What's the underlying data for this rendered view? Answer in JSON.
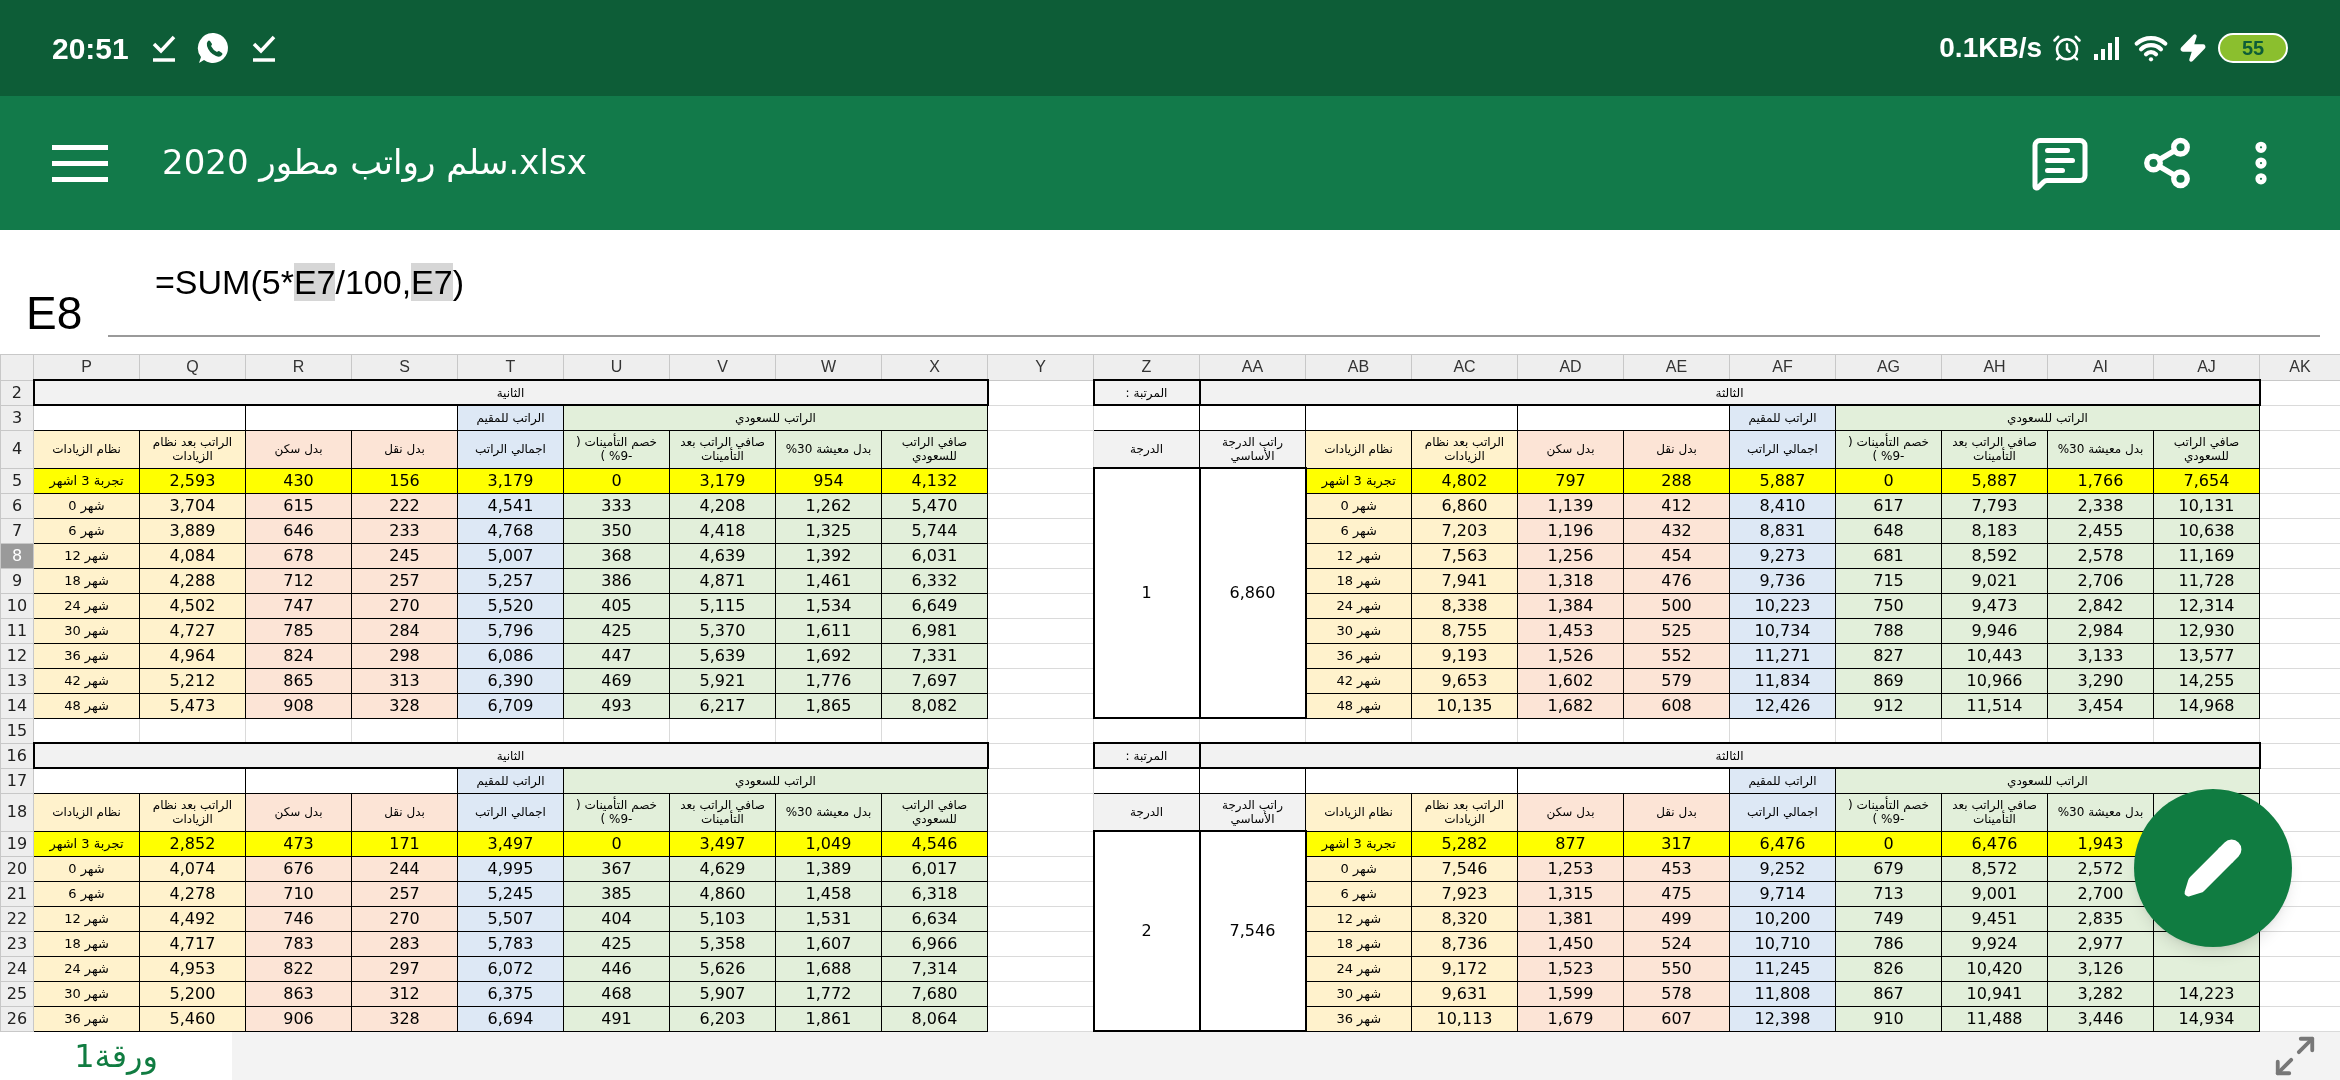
{
  "status_bar": {
    "time": "20:51",
    "network_speed": "0.1KB/s",
    "battery": "55"
  },
  "app_bar": {
    "title": "سلم رواتب مطور 2020.xlsx"
  },
  "formula_bar": {
    "cell": "E8",
    "formula": [
      {
        "text": "=SUM(5*",
        "ref": false
      },
      {
        "text": "E7",
        "ref": true
      },
      {
        "text": "/100,",
        "ref": false
      },
      {
        "text": "E7",
        "ref": true
      },
      {
        "text": ")",
        "ref": false
      }
    ]
  },
  "columns": [
    "P",
    "Q",
    "R",
    "S",
    "T",
    "U",
    "V",
    "W",
    "X",
    "Y",
    "Z",
    "AA",
    "AB",
    "AC",
    "AD",
    "AE",
    "AF",
    "AG",
    "AH",
    "AI",
    "AJ",
    "AK"
  ],
  "row_headers": [
    {
      "label": "2",
      "selected": false
    },
    {
      "label": "3",
      "selected": false
    },
    {
      "label": "4",
      "selected": false
    },
    {
      "label": "5",
      "selected": false
    },
    {
      "label": "6",
      "selected": false
    },
    {
      "label": "7",
      "selected": false
    },
    {
      "label": "8",
      "selected": true
    },
    {
      "label": "9",
      "selected": false
    },
    {
      "label": "10",
      "selected": false
    },
    {
      "label": "11",
      "selected": false
    },
    {
      "label": "12",
      "selected": false
    },
    {
      "label": "13",
      "selected": false
    },
    {
      "label": "14",
      "selected": false
    },
    {
      "label": "15",
      "selected": false
    },
    {
      "label": "16",
      "selected": false
    },
    {
      "label": "17",
      "selected": false
    },
    {
      "label": "18",
      "selected": false
    },
    {
      "label": "19",
      "selected": false
    },
    {
      "label": "20",
      "selected": false
    },
    {
      "label": "21",
      "selected": false
    },
    {
      "label": "22",
      "selected": false
    },
    {
      "label": "23",
      "selected": false
    },
    {
      "label": "24",
      "selected": false
    },
    {
      "label": "25",
      "selected": false
    },
    {
      "label": "26",
      "selected": false
    }
  ],
  "bands": [
    {
      "left": {
        "title": "الثانية",
        "resident_group": "الراتب للمقيم",
        "saudi_group": "الراتب للسعودي",
        "headers": [
          {
            "label": "صافي الراتب للسعودي",
            "color": "#e2efda"
          },
          {
            "label": "بدل معيشة 30%",
            "color": "#e2efda"
          },
          {
            "label": "صافي الراتب بعد التأمينات",
            "color": "#e2efda"
          },
          {
            "label": "خصم التأمينات ( -9% )",
            "color": "#e2efda"
          },
          {
            "label": "اجمالي الراتب",
            "color": "#dde8f5"
          },
          {
            "label": "بدل نقل",
            "color": "#fce4d6"
          },
          {
            "label": "بدل سكن",
            "color": "#fce4d6"
          },
          {
            "label": "الراتب بعد نظام الزيادات",
            "color": "#fff2cc"
          },
          {
            "label": "نظام الزيادات",
            "color": "#fff2cc"
          }
        ],
        "rows": [
          {
            "kind": "trial",
            "cells": [
              "تجربة 3 اشهر",
              "2,593",
              "430",
              "156",
              "3,179",
              "0",
              "3,179",
              "954",
              "4,132"
            ]
          },
          {
            "kind": "month",
            "cells": [
              "شهر 0",
              "3,704",
              "615",
              "222",
              "4,541",
              "333",
              "4,208",
              "1,262",
              "5,470"
            ]
          },
          {
            "kind": "month",
            "cells": [
              "شهر 6",
              "3,889",
              "646",
              "233",
              "4,768",
              "350",
              "4,418",
              "1,325",
              "5,744"
            ]
          },
          {
            "kind": "month",
            "cells": [
              "شهر 12",
              "4,084",
              "678",
              "245",
              "5,007",
              "368",
              "4,639",
              "1,392",
              "6,031"
            ]
          },
          {
            "kind": "month",
            "cells": [
              "شهر 18",
              "4,288",
              "712",
              "257",
              "5,257",
              "386",
              "4,871",
              "1,461",
              "6,332"
            ]
          },
          {
            "kind": "month",
            "cells": [
              "شهر 24",
              "4,502",
              "747",
              "270",
              "5,520",
              "405",
              "5,115",
              "1,534",
              "6,649"
            ]
          },
          {
            "kind": "month",
            "cells": [
              "شهر 30",
              "4,727",
              "785",
              "284",
              "5,796",
              "425",
              "5,370",
              "1,611",
              "6,981"
            ]
          },
          {
            "kind": "month",
            "cells": [
              "شهر 36",
              "4,964",
              "824",
              "298",
              "6,086",
              "447",
              "5,639",
              "1,692",
              "7,331"
            ]
          },
          {
            "kind": "month",
            "cells": [
              "شهر 42",
              "5,212",
              "865",
              "313",
              "6,390",
              "469",
              "5,921",
              "1,776",
              "7,697"
            ]
          },
          {
            "kind": "month",
            "cells": [
              "شهر 48",
              "5,473",
              "908",
              "328",
              "6,709",
              "493",
              "6,217",
              "1,865",
              "8,082"
            ]
          }
        ]
      },
      "right": {
        "rank_label": "المرتبة :",
        "title": "الثالثة",
        "grade_header": "الدرجة",
        "base_header": "راتب الدرجة الأساسي",
        "grade": "1",
        "base_salary": "6,860",
        "resident_group": "الراتب للمقيم",
        "saudi_group": "الراتب للسعودي",
        "headers": [
          {
            "label": "صافي الراتب للسعودي",
            "color": "#e2efda"
          },
          {
            "label": "بدل معيشة 30%",
            "color": "#e2efda"
          },
          {
            "label": "صافي الراتب بعد التأمينات",
            "color": "#e2efda"
          },
          {
            "label": "خصم التأمينات ( -9% )",
            "color": "#e2efda"
          },
          {
            "label": "اجمالي الراتب",
            "color": "#dde8f5"
          },
          {
            "label": "بدل نقل",
            "color": "#fce4d6"
          },
          {
            "label": "بدل سكن",
            "color": "#fce4d6"
          },
          {
            "label": "الراتب بعد نظام الزيادات",
            "color": "#fff2cc"
          },
          {
            "label": "نظام الزيادات",
            "color": "#fff2cc"
          }
        ],
        "rows": [
          {
            "kind": "trial",
            "cells": [
              "تجربة 3 اشهر",
              "4,802",
              "797",
              "288",
              "5,887",
              "0",
              "5,887",
              "1,766",
              "7,654"
            ]
          },
          {
            "kind": "month",
            "cells": [
              "شهر 0",
              "6,860",
              "1,139",
              "412",
              "8,410",
              "617",
              "7,793",
              "2,338",
              "10,131"
            ]
          },
          {
            "kind": "month",
            "cells": [
              "شهر 6",
              "7,203",
              "1,196",
              "432",
              "8,831",
              "648",
              "8,183",
              "2,455",
              "10,638"
            ]
          },
          {
            "kind": "month",
            "cells": [
              "شهر 12",
              "7,563",
              "1,256",
              "454",
              "9,273",
              "681",
              "8,592",
              "2,578",
              "11,169"
            ]
          },
          {
            "kind": "month",
            "cells": [
              "شهر 18",
              "7,941",
              "1,318",
              "476",
              "9,736",
              "715",
              "9,021",
              "2,706",
              "11,728"
            ]
          },
          {
            "kind": "month",
            "cells": [
              "شهر 24",
              "8,338",
              "1,384",
              "500",
              "10,223",
              "750",
              "9,473",
              "2,842",
              "12,314"
            ]
          },
          {
            "kind": "month",
            "cells": [
              "شهر 30",
              "8,755",
              "1,453",
              "525",
              "10,734",
              "788",
              "9,946",
              "2,984",
              "12,930"
            ]
          },
          {
            "kind": "month",
            "cells": [
              "شهر 36",
              "9,193",
              "1,526",
              "552",
              "11,271",
              "827",
              "10,443",
              "3,133",
              "13,577"
            ]
          },
          {
            "kind": "month",
            "cells": [
              "شهر 42",
              "9,653",
              "1,602",
              "579",
              "11,834",
              "869",
              "10,966",
              "3,290",
              "14,255"
            ]
          },
          {
            "kind": "month",
            "cells": [
              "شهر 48",
              "10,135",
              "1,682",
              "608",
              "12,426",
              "912",
              "11,514",
              "3,454",
              "14,968"
            ]
          }
        ]
      }
    },
    {
      "left": {
        "title": "الثانية",
        "resident_group": "الراتب للمقيم",
        "saudi_group": "الراتب للسعودي",
        "headers": [
          {
            "label": "صافي الراتب للسعودي",
            "color": "#e2efda"
          },
          {
            "label": "بدل معيشة 30%",
            "color": "#e2efda"
          },
          {
            "label": "صافي الراتب بعد التأمينات",
            "color": "#e2efda"
          },
          {
            "label": "خصم التأمينات ( -9% )",
            "color": "#e2efda"
          },
          {
            "label": "اجمالي الراتب",
            "color": "#dde8f5"
          },
          {
            "label": "بدل نقل",
            "color": "#fce4d6"
          },
          {
            "label": "بدل سكن",
            "color": "#fce4d6"
          },
          {
            "label": "الراتب بعد نظام الزيادات",
            "color": "#fff2cc"
          },
          {
            "label": "نظام الزيادات",
            "color": "#fff2cc"
          }
        ],
        "rows": [
          {
            "kind": "trial",
            "cells": [
              "تجربة 3 اشهر",
              "2,852",
              "473",
              "171",
              "3,497",
              "0",
              "3,497",
              "1,049",
              "4,546"
            ]
          },
          {
            "kind": "month",
            "cells": [
              "شهر 0",
              "4,074",
              "676",
              "244",
              "4,995",
              "367",
              "4,629",
              "1,389",
              "6,017"
            ]
          },
          {
            "kind": "month",
            "cells": [
              "شهر 6",
              "4,278",
              "710",
              "257",
              "5,245",
              "385",
              "4,860",
              "1,458",
              "6,318"
            ]
          },
          {
            "kind": "month",
            "cells": [
              "شهر 12",
              "4,492",
              "746",
              "270",
              "5,507",
              "404",
              "5,103",
              "1,531",
              "6,634"
            ]
          },
          {
            "kind": "month",
            "cells": [
              "شهر 18",
              "4,717",
              "783",
              "283",
              "5,783",
              "425",
              "5,358",
              "1,607",
              "6,966"
            ]
          },
          {
            "kind": "month",
            "cells": [
              "شهر 24",
              "4,953",
              "822",
              "297",
              "6,072",
              "446",
              "5,626",
              "1,688",
              "7,314"
            ]
          },
          {
            "kind": "month",
            "cells": [
              "شهر 30",
              "5,200",
              "863",
              "312",
              "6,375",
              "468",
              "5,907",
              "1,772",
              "7,680"
            ]
          },
          {
            "kind": "month",
            "cells": [
              "شهر 36",
              "5,460",
              "906",
              "328",
              "6,694",
              "491",
              "6,203",
              "1,861",
              "8,064"
            ]
          }
        ]
      },
      "right": {
        "rank_label": "المرتبة :",
        "title": "الثالثة",
        "grade_header": "الدرجة",
        "base_header": "راتب الدرجة الأساسي",
        "grade": "2",
        "base_salary": "7,546",
        "resident_group": "الراتب للمقيم",
        "saudi_group": "الراتب للسعودي",
        "headers": [
          {
            "color": "#e2efda"
          },
          {
            "label": "بدل معيشة 30%",
            "color": "#e2efda"
          },
          {
            "label": "صافي الراتب بعد التأمينات",
            "color": "#e2efda"
          },
          {
            "label": "خصم التأمينات ( -9% )",
            "color": "#e2efda"
          },
          {
            "label": "اجمالي الراتب",
            "color": "#dde8f5"
          },
          {
            "label": "بدل نقل",
            "color": "#fce4d6"
          },
          {
            "label": "بدل سكن",
            "color": "#fce4d6"
          },
          {
            "label": "الراتب بعد نظام الزيادات",
            "color": "#fff2cc"
          },
          {
            "label": "نظام الزيادات",
            "color": "#fff2cc"
          }
        ],
        "rows": [
          {
            "kind": "trial",
            "cells": [
              "تجربة 3 اشهر",
              "5,282",
              "877",
              "317",
              "6,476",
              "0",
              "6,476",
              "1,943"
            ]
          },
          {
            "kind": "month",
            "cells": [
              "شهر 0",
              "7,546",
              "1,253",
              "453",
              "9,252",
              "679",
              "8,572",
              "2,572"
            ]
          },
          {
            "kind": "month",
            "cells": [
              "شهر 6",
              "7,923",
              "1,315",
              "475",
              "9,714",
              "713",
              "9,001",
              "2,700"
            ]
          },
          {
            "kind": "month",
            "cells": [
              "شهر 12",
              "8,320",
              "1,381",
              "499",
              "10,200",
              "749",
              "9,451",
              "2,835"
            ]
          },
          {
            "kind": "month",
            "cells": [
              "شهر 18",
              "8,736",
              "1,450",
              "524",
              "10,710",
              "786",
              "9,924",
              "2,977"
            ]
          },
          {
            "kind": "month",
            "cells": [
              "شهر 24",
              "9,172",
              "1,523",
              "550",
              "11,245",
              "826",
              "10,420",
              "3,126"
            ]
          },
          {
            "kind": "month",
            "cells": [
              "شهر 30",
              "9,631",
              "1,599",
              "578",
              "11,808",
              "867",
              "10,941",
              "3,282",
              "14,223"
            ]
          },
          {
            "kind": "month",
            "cells": [
              "شهر 36",
              "10,113",
              "1,679",
              "607",
              "12,398",
              "910",
              "11,488",
              "3,446",
              "14,934"
            ]
          }
        ]
      }
    }
  ],
  "sheet_tabs": [
    {
      "label": "ورقة1",
      "selected": true
    }
  ]
}
